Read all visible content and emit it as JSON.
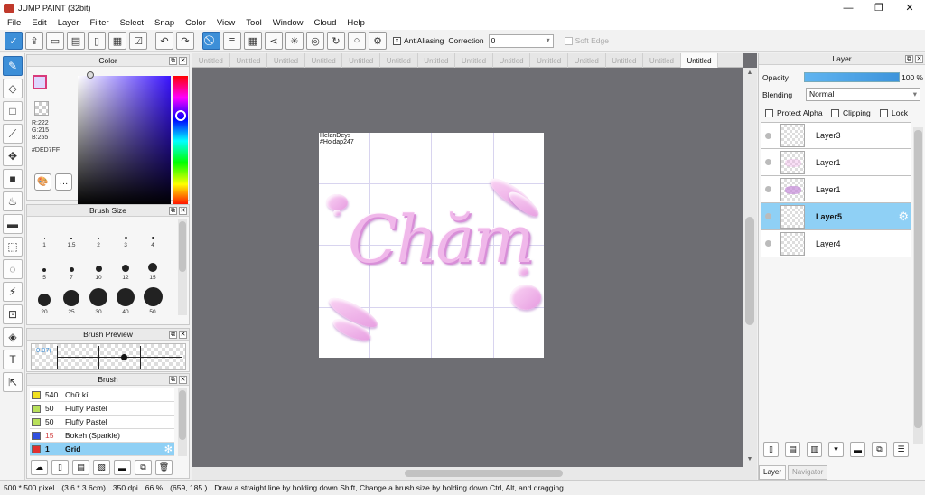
{
  "window": {
    "title": "JUMP PAINT (32bit)",
    "controls": [
      "—",
      "❐",
      "✕"
    ]
  },
  "menu": [
    "File",
    "Edit",
    "Layer",
    "Filter",
    "Select",
    "Snap",
    "Color",
    "View",
    "Tool",
    "Window",
    "Cloud",
    "Help"
  ],
  "toolbar": {
    "antialiasing_label": "AntiAliasing",
    "antialiasing_checked": "x",
    "correction_label": "Correction",
    "correction_value": "0",
    "soft_edge_label": "Soft Edge"
  },
  "color_panel": {
    "title": "Color",
    "fg_color": "#DED7FF",
    "r": "R:222",
    "g": "G:215",
    "b": "B:255",
    "hex": "#DED7FF"
  },
  "brush_size_panel": {
    "title": "Brush Size",
    "sizes": [
      "1",
      "1.5",
      "2",
      "3",
      "4",
      "5",
      "7",
      "10",
      "12",
      "15",
      "20",
      "25",
      "30",
      "40",
      "50"
    ]
  },
  "brush_preview_panel": {
    "title": "Brush Preview",
    "value": "0.07("
  },
  "brush_panel": {
    "title": "Brush",
    "items": [
      {
        "size": "540",
        "name": "Chữ kí",
        "color": "#f0e020"
      },
      {
        "size": "50",
        "name": "Fluffy Pastel",
        "color": "#b8e05a"
      },
      {
        "size": "50",
        "name": "Fluffy Pastel",
        "color": "#b8e05a"
      },
      {
        "size": "15",
        "name": "Bokeh (Sparkle)",
        "color": "#3050e0"
      },
      {
        "size": "1",
        "name": "Grid",
        "color": "#e03030"
      }
    ]
  },
  "tabs": [
    "Untitled",
    "Untitled",
    "Untitled",
    "Untitled",
    "Untitled",
    "Untitled",
    "Untitled",
    "Untitled",
    "Untitled",
    "Untitled",
    "Untitled",
    "Untitled",
    "Untitled",
    "Untitled"
  ],
  "canvas": {
    "watermark_line1": "HelanDeys",
    "watermark_line2": "#Hoidap247",
    "artwork_text": "Chăm"
  },
  "layer_panel": {
    "title": "Layer",
    "opacity_label": "Opacity",
    "opacity_value": "100 %",
    "blending_label": "Blending",
    "blending_value": "Normal",
    "protect_alpha": "Protect Alpha",
    "clipping": "Clipping",
    "lock": "Lock",
    "layers": [
      "Layer3",
      "Layer1",
      "Layer1",
      "Layer5",
      "Layer4"
    ],
    "tab_layer": "Layer",
    "tab_navigator": "Navigator"
  },
  "statusbar": {
    "size": "500 * 500 pixel",
    "cm": "(3.6 * 3.6cm)",
    "dpi": "350 dpi",
    "zoom": "66 %",
    "coords": "(659, 185 )",
    "hint": "Draw a straight line by holding down Shift, Change a brush size by holding down Ctrl, Alt, and dragging"
  }
}
